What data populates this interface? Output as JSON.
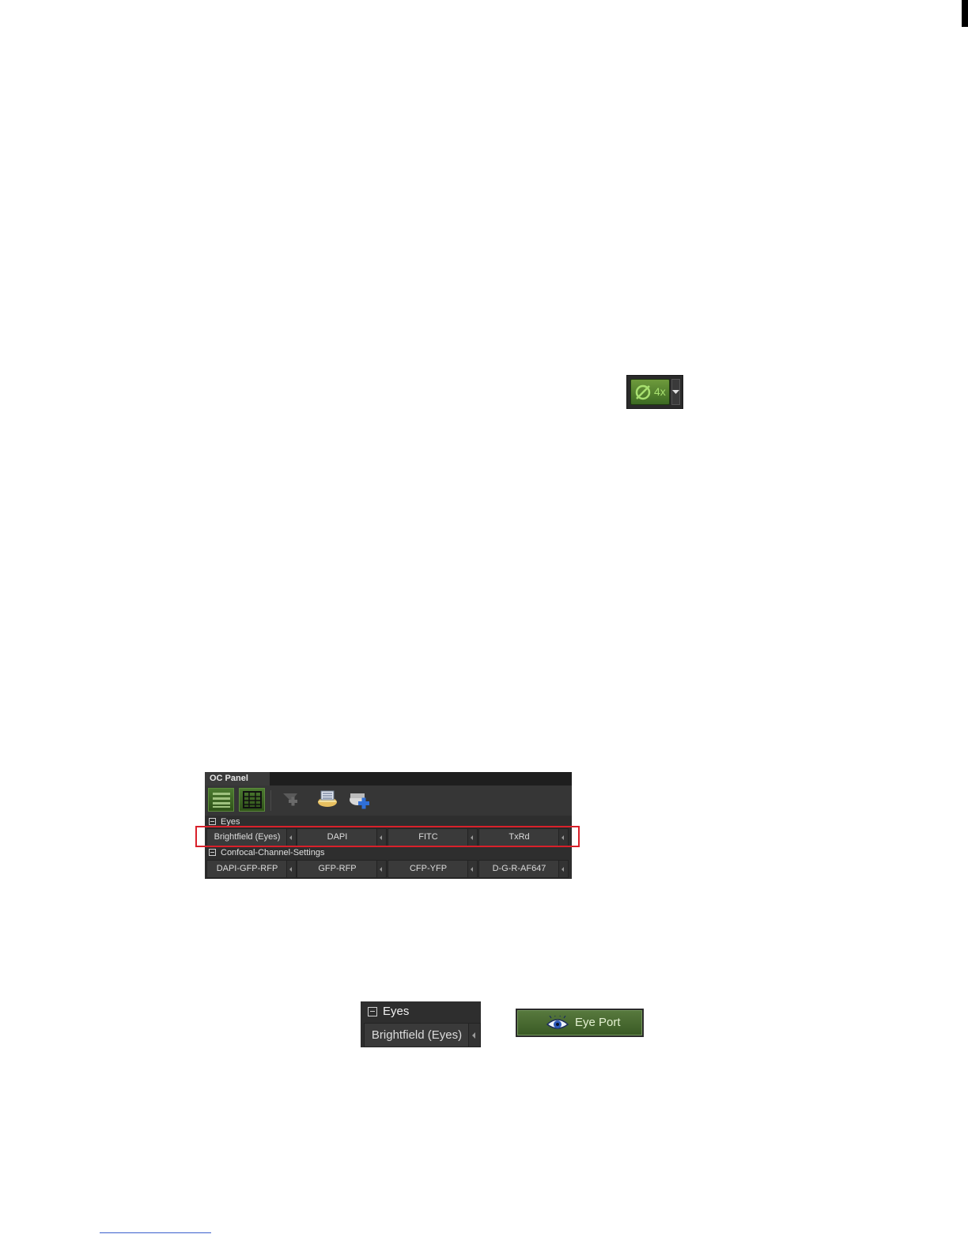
{
  "objective": {
    "label": "4x",
    "icon": "objective-slash-icon",
    "dropdown_icon": "chevron-down-icon"
  },
  "oc_panel": {
    "tab": "OC Panel",
    "toolbar": [
      "list-view-icon",
      "grid-view-icon",
      "remove-oc-icon",
      "edit-oc-icon",
      "add-oc-icon"
    ],
    "groups": [
      {
        "label": "Eyes",
        "items": [
          "Brightfield (Eyes)",
          "DAPI",
          "FITC",
          "TxRd"
        ]
      },
      {
        "label": "Confocal-Channel-Settings",
        "items": [
          "DAPI-GFP-RFP",
          "GFP-RFP",
          "CFP-YFP",
          "D-G-R-AF647"
        ]
      }
    ],
    "highlight_color": "#d9202a"
  },
  "eyes_crop": {
    "group_label": "Eyes",
    "item": "Brightfield (Eyes)"
  },
  "eye_port": {
    "label": "Eye Port",
    "icon": "eye-icon"
  },
  "colors": {
    "panel_bg": "#2e2e2e",
    "accent_green": "#4c7a30",
    "highlight_red": "#d9202a"
  }
}
